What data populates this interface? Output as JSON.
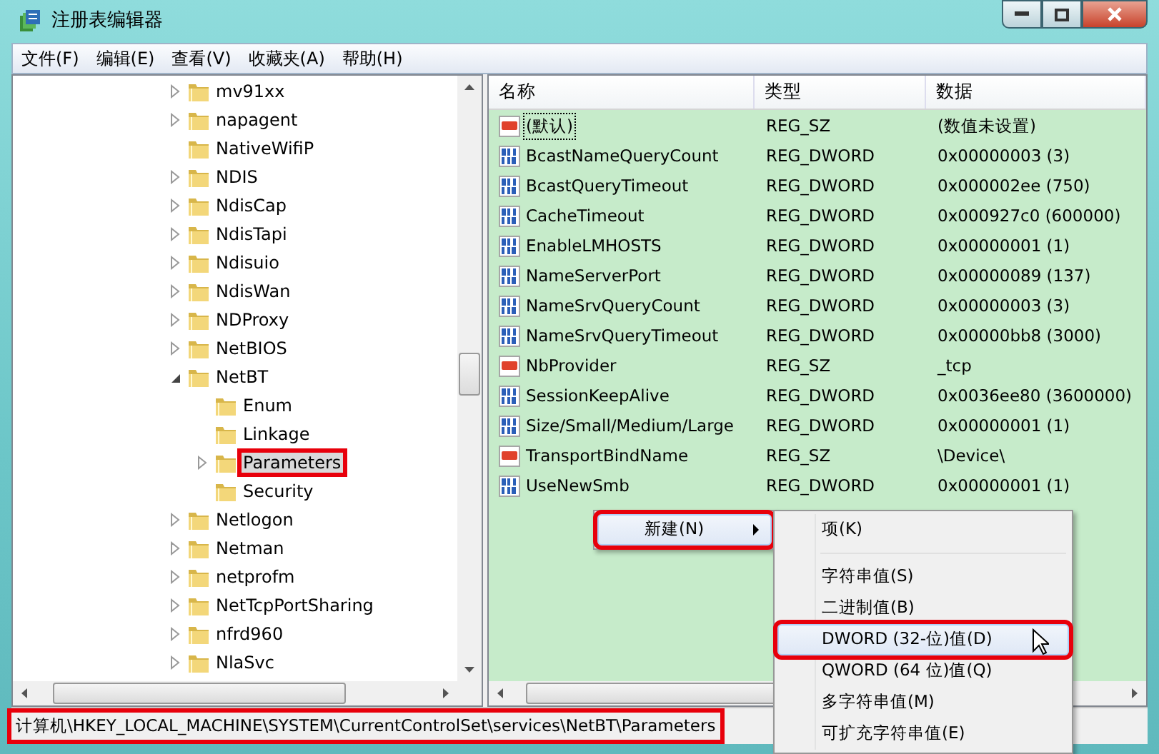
{
  "window": {
    "title": "注册表编辑器"
  },
  "menu_bar": [
    "文件(F)",
    "编辑(E)",
    "查看(V)",
    "收藏夹(A)",
    "帮助(H)"
  ],
  "tree": [
    {
      "label": "mv91xx",
      "expandable": true,
      "expanded": false,
      "selected": false,
      "highlighted": false
    },
    {
      "label": "napagent",
      "expandable": true,
      "expanded": false,
      "selected": false,
      "highlighted": false
    },
    {
      "label": "NativeWifiP",
      "expandable": false,
      "selected": false,
      "highlighted": false
    },
    {
      "label": "NDIS",
      "expandable": true,
      "expanded": false,
      "selected": false,
      "highlighted": false
    },
    {
      "label": "NdisCap",
      "expandable": true,
      "expanded": false,
      "selected": false,
      "highlighted": false
    },
    {
      "label": "NdisTapi",
      "expandable": true,
      "expanded": false,
      "selected": false,
      "highlighted": false
    },
    {
      "label": "Ndisuio",
      "expandable": true,
      "expanded": false,
      "selected": false,
      "highlighted": false
    },
    {
      "label": "NdisWan",
      "expandable": true,
      "expanded": false,
      "selected": false,
      "highlighted": false
    },
    {
      "label": "NDProxy",
      "expandable": true,
      "expanded": false,
      "selected": false,
      "highlighted": false
    },
    {
      "label": "NetBIOS",
      "expandable": true,
      "expanded": false,
      "selected": false,
      "highlighted": false
    },
    {
      "label": "NetBT",
      "expandable": true,
      "expanded": true,
      "selected": false,
      "highlighted": false,
      "children": [
        {
          "label": "Enum",
          "expandable": false,
          "selected": false,
          "highlighted": false
        },
        {
          "label": "Linkage",
          "expandable": false,
          "selected": false,
          "highlighted": false
        },
        {
          "label": "Parameters",
          "expandable": true,
          "expanded": false,
          "selected": true,
          "highlighted": true
        },
        {
          "label": "Security",
          "expandable": false,
          "selected": false,
          "highlighted": false
        }
      ]
    },
    {
      "label": "Netlogon",
      "expandable": true,
      "expanded": false,
      "selected": false,
      "highlighted": false
    },
    {
      "label": "Netman",
      "expandable": true,
      "expanded": false,
      "selected": false,
      "highlighted": false
    },
    {
      "label": "netprofm",
      "expandable": true,
      "expanded": false,
      "selected": false,
      "highlighted": false
    },
    {
      "label": "NetTcpPortSharing",
      "expandable": true,
      "expanded": false,
      "selected": false,
      "highlighted": false
    },
    {
      "label": "nfrd960",
      "expandable": true,
      "expanded": false,
      "selected": false,
      "highlighted": false
    },
    {
      "label": "NlaSvc",
      "expandable": true,
      "expanded": false,
      "selected": false,
      "highlighted": false
    }
  ],
  "table": {
    "columns": [
      "名称",
      "类型",
      "数据"
    ],
    "rows": [
      {
        "kind": "string",
        "focused": true,
        "name": "(默认)",
        "type": "REG_SZ",
        "data": "(数值未设置)"
      },
      {
        "kind": "number",
        "focused": false,
        "name": "BcastNameQueryCount",
        "type": "REG_DWORD",
        "data": "0x00000003 (3)"
      },
      {
        "kind": "number",
        "focused": false,
        "name": "BcastQueryTimeout",
        "type": "REG_DWORD",
        "data": "0x000002ee (750)"
      },
      {
        "kind": "number",
        "focused": false,
        "name": "CacheTimeout",
        "type": "REG_DWORD",
        "data": "0x000927c0 (600000)"
      },
      {
        "kind": "number",
        "focused": false,
        "name": "EnableLMHOSTS",
        "type": "REG_DWORD",
        "data": "0x00000001 (1)"
      },
      {
        "kind": "number",
        "focused": false,
        "name": "NameServerPort",
        "type": "REG_DWORD",
        "data": "0x00000089 (137)"
      },
      {
        "kind": "number",
        "focused": false,
        "name": "NameSrvQueryCount",
        "type": "REG_DWORD",
        "data": "0x00000003 (3)"
      },
      {
        "kind": "number",
        "focused": false,
        "name": "NameSrvQueryTimeout",
        "type": "REG_DWORD",
        "data": "0x00000bb8 (3000)"
      },
      {
        "kind": "string",
        "focused": false,
        "name": "NbProvider",
        "type": "REG_SZ",
        "data": "_tcp"
      },
      {
        "kind": "number",
        "focused": false,
        "name": "SessionKeepAlive",
        "type": "REG_DWORD",
        "data": "0x0036ee80 (3600000)"
      },
      {
        "kind": "number",
        "focused": false,
        "name": "Size/Small/Medium/Large",
        "type": "REG_DWORD",
        "data": "0x00000001 (1)"
      },
      {
        "kind": "string",
        "focused": false,
        "name": "TransportBindName",
        "type": "REG_SZ",
        "data": "\\Device\\"
      },
      {
        "kind": "number",
        "focused": false,
        "name": "UseNewSmb",
        "type": "REG_DWORD",
        "data": "0x00000001 (1)"
      }
    ]
  },
  "context_menu": [
    {
      "label": "新建(N)",
      "submenu": true,
      "selected": true,
      "highlighted": true
    }
  ],
  "submenu": [
    {
      "kind": "item",
      "label": "项(K)",
      "selected": false,
      "highlighted": false
    },
    {
      "kind": "separator"
    },
    {
      "kind": "item",
      "label": "字符串值(S)",
      "selected": false,
      "highlighted": false
    },
    {
      "kind": "item",
      "label": "二进制值(B)",
      "selected": false,
      "highlighted": false
    },
    {
      "kind": "item",
      "label": "DWORD (32-位)值(D)",
      "selected": true,
      "highlighted": true
    },
    {
      "kind": "item",
      "label": "QWORD (64 位)值(Q)",
      "selected": false,
      "highlighted": false
    },
    {
      "kind": "item",
      "label": "多字符串值(M)",
      "selected": false,
      "highlighted": false
    },
    {
      "kind": "item",
      "label": "可扩充字符串值(E)",
      "selected": false,
      "highlighted": false
    }
  ],
  "status_bar": {
    "path": "计算机\\HKEY_LOCAL_MACHINE\\SYSTEM\\CurrentControlSet\\services\\NetBT\\Parameters",
    "highlighted": true
  }
}
